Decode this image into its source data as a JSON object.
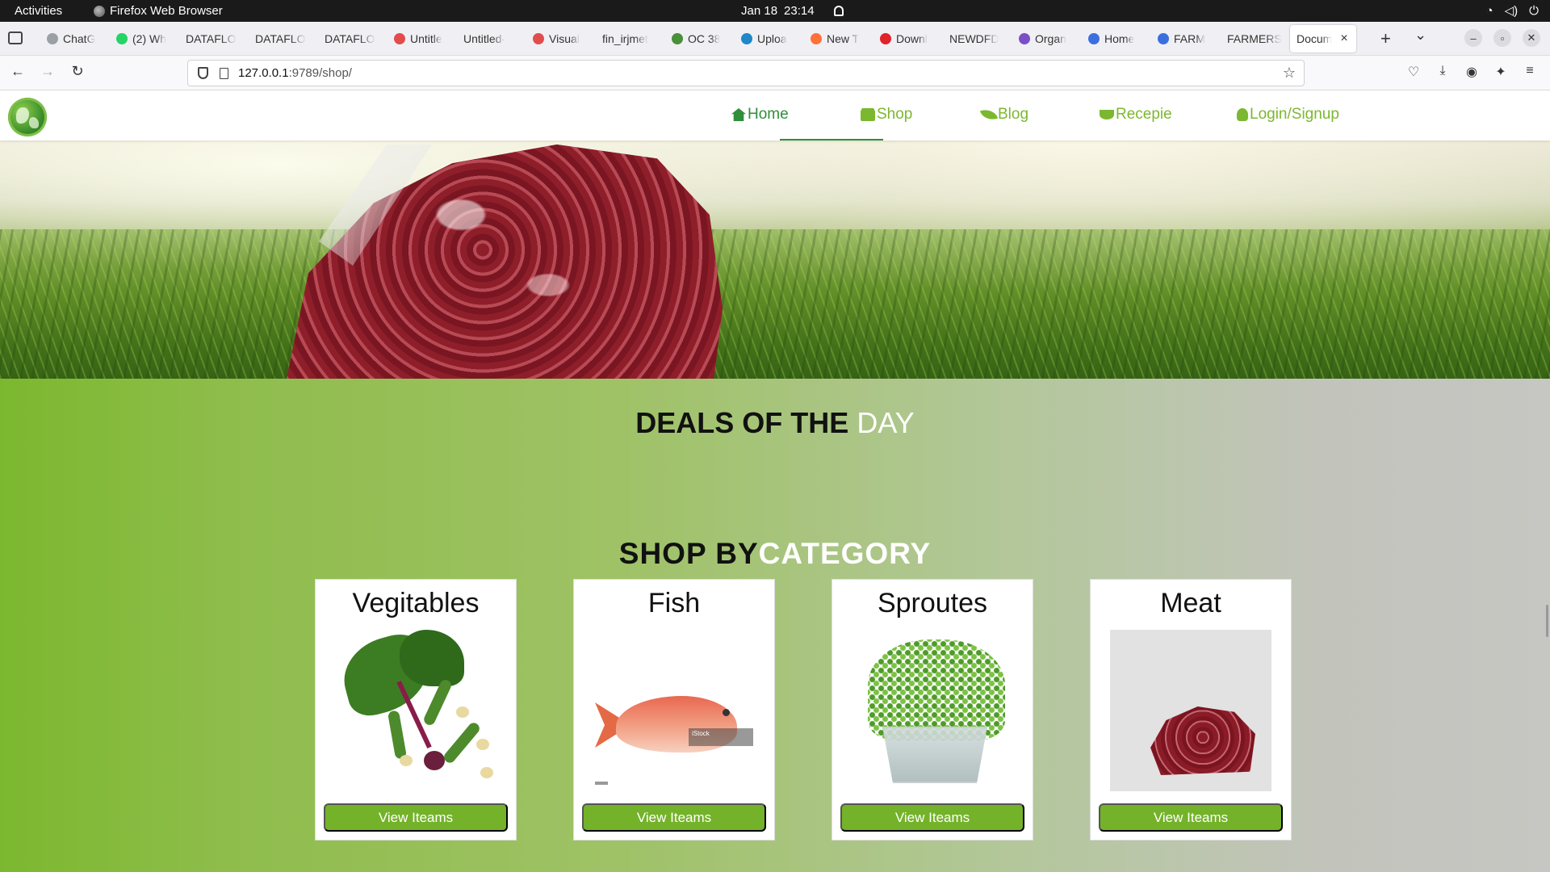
{
  "system": {
    "activities": "Activities",
    "app_name": "Firefox Web Browser",
    "date": "Jan 18",
    "time": "23:14"
  },
  "browser": {
    "tabs": [
      {
        "label": "ChatG",
        "color": "#9aa0a6"
      },
      {
        "label": "(2) Wh",
        "color": "#25d366"
      },
      {
        "label": "DATAFLO",
        "color": ""
      },
      {
        "label": "DATAFLO",
        "color": ""
      },
      {
        "label": "DATAFLO",
        "color": ""
      },
      {
        "label": "Untitle",
        "color": "#e34c4c"
      },
      {
        "label": "Untitled-",
        "color": ""
      },
      {
        "label": "Visual",
        "color": "#e34c4c"
      },
      {
        "label": "fin_irjmet",
        "color": ""
      },
      {
        "label": "OC 38",
        "color": "#4a8f3a"
      },
      {
        "label": "Uploa",
        "color": "#1e88c8"
      },
      {
        "label": "New T",
        "color": "#ff7139"
      },
      {
        "label": "Downl",
        "color": "#e0222a"
      },
      {
        "label": "NEWDFD",
        "color": ""
      },
      {
        "label": "Organ",
        "color": "#7b4fc8"
      },
      {
        "label": "Home",
        "color": "#3b6fe0"
      },
      {
        "label": "FARM",
        "color": "#3b6fe0"
      },
      {
        "label": "FARMERS",
        "color": ""
      },
      {
        "label": "Docum",
        "color": "",
        "active": true
      }
    ],
    "url_host": "127.0.0.1",
    "url_rest": ":9789/shop/"
  },
  "site": {
    "nav": {
      "home": "Home",
      "shop": "Shop",
      "blog": "Blog",
      "recipe": "Recepie",
      "login": "Login/Signup"
    },
    "deals_bold": "DEALS OF THE",
    "deals_light": "DAY",
    "shop_by": "SHOP BY",
    "category": "CATEGORY",
    "categories": [
      {
        "title": "Vegitables",
        "button": "View Iteams"
      },
      {
        "title": "Fish",
        "button": "View Iteams",
        "watermark": "iStock"
      },
      {
        "title": "Sproutes",
        "button": "View Iteams"
      },
      {
        "title": "Meat",
        "button": "View Iteams"
      }
    ]
  },
  "colors": {
    "accent_green": "#74b22a",
    "active_nav": "#2f8f3a"
  }
}
